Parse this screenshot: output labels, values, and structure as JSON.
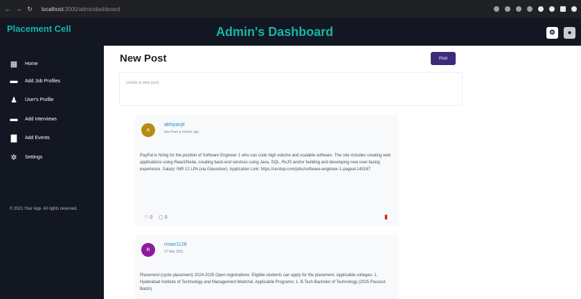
{
  "browser": {
    "url_host": "localhost",
    "url_path": ":3000/admindashboard"
  },
  "header": {
    "brand": "Placement Cell",
    "title": "Admin's Dashboard"
  },
  "sidebar": {
    "items": [
      {
        "label": "Home",
        "icon": "home-icon"
      },
      {
        "label": "Add Job Profiles",
        "icon": "car-icon"
      },
      {
        "label": "User's Profile",
        "icon": "user-icon"
      },
      {
        "label": "Add Interviews",
        "icon": "car-icon"
      },
      {
        "label": "Add Events",
        "icon": "calendar-icon"
      },
      {
        "label": "Settings",
        "icon": "gear-icon"
      }
    ],
    "footer": "© 2021 Your App. All rights reserved."
  },
  "main": {
    "title": "New Post",
    "post_button": "Post",
    "input_placeholder": "create a new post"
  },
  "posts": [
    {
      "avatar_letter": "A",
      "avatar_color": "#b78a12",
      "username": "abhiyanjit",
      "time": "less than a minute ago",
      "body": "PayPal is hiring for the position of Software Engineer 1 who can code high volume and scalable software. The role includes creating web applications using React/Node, creating back-end services using Java, SQL, RxJS and/or building and developing new user-facing experience. Salary: INR 12 LPA (via Glassdoor). Application Link: https://unstop.com/jobs/software-engineer-1-paypal-145187",
      "likes": "0",
      "comments": "0"
    },
    {
      "avatar_letter": "R",
      "avatar_color": "#8e1a9e",
      "username": "rnsan1128",
      "time": "17 Mar 2021",
      "body": "Placement (cycle placement) 2024-2025 Open registrations: Eligible students can apply for the placement. Applicable colleges: 1. Hyderabad Institute of Technology and Management Medchal. Applicable Programs: 1. B.Tech Bachelor of Technology (2025 Passout Batch)"
    }
  ]
}
